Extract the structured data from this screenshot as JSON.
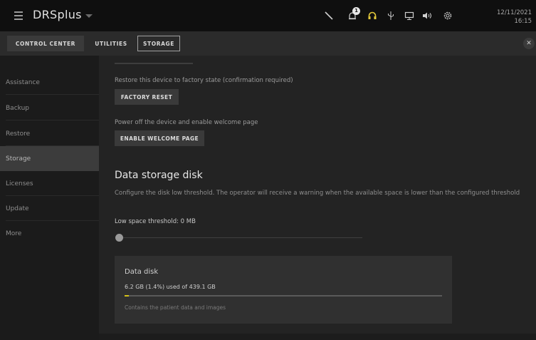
{
  "app": {
    "title": "DRSplus",
    "notification_count": "1"
  },
  "datetime": {
    "date": "12/11/2021",
    "time": "16:15"
  },
  "tabs": [
    {
      "label": "CONTROL CENTER"
    },
    {
      "label": "UTILITIES"
    },
    {
      "label": "STORAGE"
    }
  ],
  "sidebar": {
    "items": [
      {
        "label": "Assistance"
      },
      {
        "label": "Backup"
      },
      {
        "label": "Restore"
      },
      {
        "label": "Storage",
        "active": true
      },
      {
        "label": "Licenses"
      },
      {
        "label": "Update"
      },
      {
        "label": "More"
      }
    ]
  },
  "main": {
    "factory": {
      "description": "Restore this device to factory state (confirmation required)",
      "button": "FACTORY RESET"
    },
    "welcome": {
      "description": "Power off the device and enable welcome page",
      "button": "ENABLE WELCOME PAGE"
    },
    "storage": {
      "title": "Data storage disk",
      "description": "Configure the disk low threshold. The operator will receive a warning when the available space is lower than the configured threshold",
      "threshold_label": "Low space threshold: 0 MB",
      "threshold_value": 0
    },
    "disk": {
      "title": "Data disk",
      "usage": "6.2 GB (1.4%) used of 439.1 GB",
      "used_fraction": 0.014,
      "note": "Contains the patient data and images"
    }
  },
  "colors": {
    "accent_bar": "#d4c21a",
    "headset_icon": "#e2c83a"
  },
  "icons": [
    "menu-icon",
    "wand-icon",
    "bell-icon",
    "headset-icon",
    "usb-icon",
    "monitor-icon",
    "speaker-icon",
    "gear-icon",
    "close-icon"
  ]
}
